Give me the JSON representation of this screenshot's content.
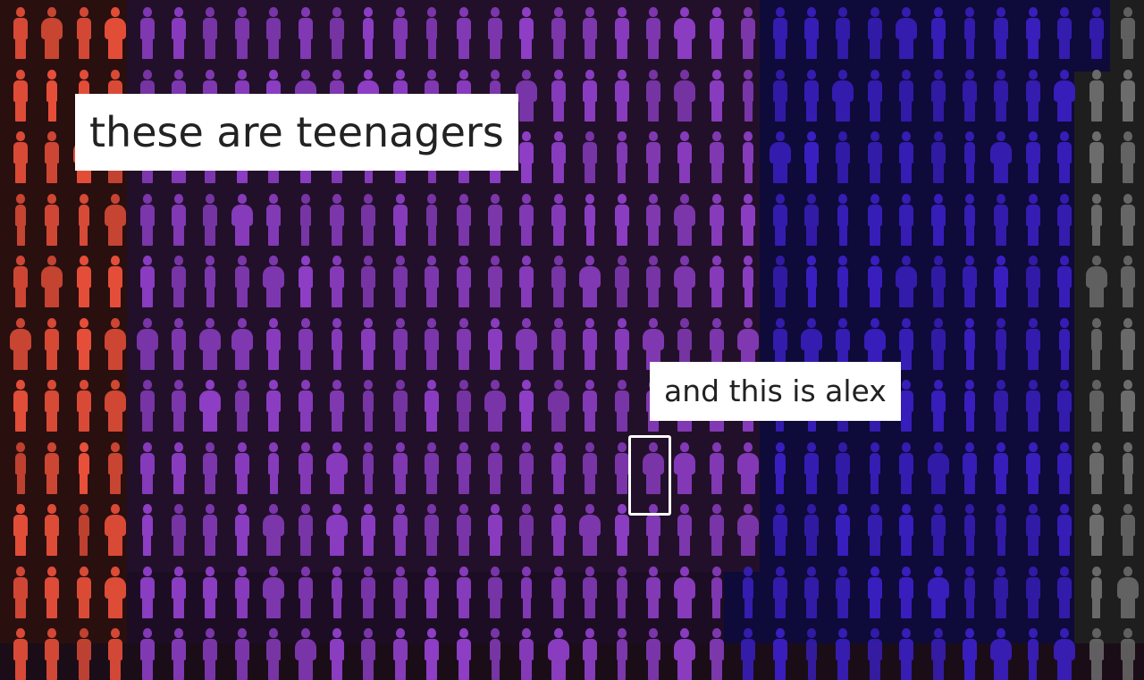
{
  "captions": {
    "teenagers": "these are teenagers",
    "alex": "and this is alex"
  },
  "colors": {
    "red_group": "#e8503a",
    "purple_group": "#8d3ec4",
    "blue_group": "#3a1fc0",
    "gray_group": "#6e6e6e",
    "caption_bg": "#ffffff",
    "caption_text": "#222222",
    "highlight": "#ffffff"
  },
  "crowd": {
    "figure_icon": "person-silhouette-icon",
    "groups": [
      "red",
      "purple",
      "blue",
      "gray"
    ]
  },
  "highlighted_person": "alex"
}
